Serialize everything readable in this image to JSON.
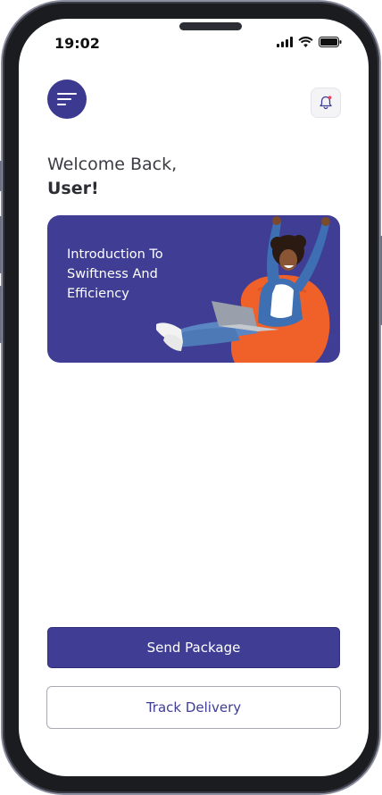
{
  "status_bar": {
    "time": "19:02",
    "icons": [
      "cellular-signal-icon",
      "wifi-icon",
      "battery-icon"
    ]
  },
  "header": {
    "menu_icon": "menu-lines-icon",
    "notification_icon": "bell-icon",
    "notification_dot_color": "#e4475d"
  },
  "greeting": {
    "line1": "Welcome Back,",
    "line2": "User!"
  },
  "banner": {
    "line1": "Introduction To",
    "line2": "Swiftness And",
    "line3": "Efficiency",
    "background": "#3f3d94",
    "art_description": "person-on-beanbag-with-laptop"
  },
  "actions": {
    "primary_label": "Send  Package",
    "secondary_label": "Track Delivery"
  },
  "colors": {
    "brand": "#3f3d94",
    "accent_orange": "#f0612a"
  }
}
